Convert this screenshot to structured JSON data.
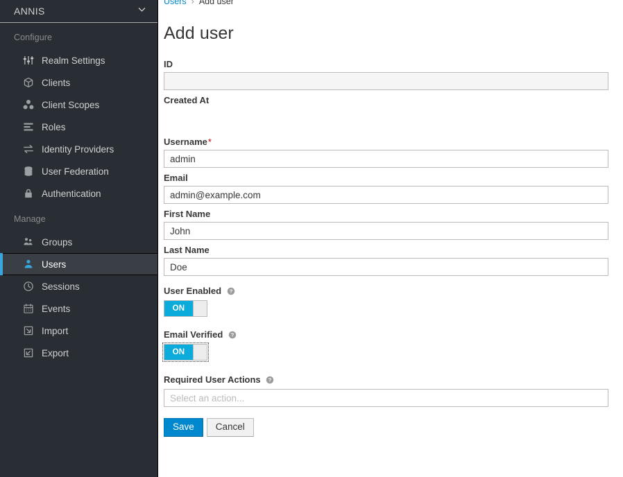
{
  "sidebar": {
    "realm": {
      "name": "ANNIS",
      "chevron_icon": "chevron-down-icon"
    },
    "sections": [
      {
        "title": "Configure",
        "items": [
          {
            "label": "Realm Settings",
            "icon": "sliders-icon",
            "active": false
          },
          {
            "label": "Clients",
            "icon": "cube-icon",
            "active": false
          },
          {
            "label": "Client Scopes",
            "icon": "molecule-icon",
            "active": false
          },
          {
            "label": "Roles",
            "icon": "list-bars-icon",
            "active": false
          },
          {
            "label": "Identity Providers",
            "icon": "exchange-arrows-icon",
            "active": false
          },
          {
            "label": "User Federation",
            "icon": "database-icon",
            "active": false
          },
          {
            "label": "Authentication",
            "icon": "lock-icon",
            "active": false
          }
        ]
      },
      {
        "title": "Manage",
        "items": [
          {
            "label": "Groups",
            "icon": "users-group-icon",
            "active": false
          },
          {
            "label": "Users",
            "icon": "user-icon",
            "active": true
          },
          {
            "label": "Sessions",
            "icon": "clock-icon",
            "active": false
          },
          {
            "label": "Events",
            "icon": "calendar-icon",
            "active": false
          },
          {
            "label": "Import",
            "icon": "import-arrow-icon",
            "active": false
          },
          {
            "label": "Export",
            "icon": "export-arrow-icon",
            "active": false
          }
        ]
      }
    ]
  },
  "breadcrumb": {
    "parent": "Users",
    "separator": "›",
    "current": "Add user"
  },
  "page": {
    "title": "Add user"
  },
  "form": {
    "id": {
      "label": "ID",
      "value": "",
      "placeholder": ""
    },
    "created_at": {
      "label": "Created At",
      "value": ""
    },
    "username": {
      "label": "Username",
      "required_marker": "*",
      "value": "admin"
    },
    "email": {
      "label": "Email",
      "value": "admin@example.com"
    },
    "first_name": {
      "label": "First Name",
      "value": "John"
    },
    "last_name": {
      "label": "Last Name",
      "value": "Doe"
    },
    "user_enabled": {
      "label": "User Enabled",
      "state": "ON",
      "help_icon": "help-circle-icon"
    },
    "email_verified": {
      "label": "Email Verified",
      "state": "ON",
      "help_icon": "help-circle-icon"
    },
    "required_user_actions": {
      "label": "Required User Actions",
      "placeholder": "Select an action...",
      "value": "",
      "help_icon": "help-circle-icon"
    }
  },
  "actions": {
    "save_label": "Save",
    "cancel_label": "Cancel"
  },
  "colors": {
    "sidebar_bg": "#292e34",
    "sidebar_active_bg": "#393f44",
    "accent_blue": "#39a5dc",
    "primary_blue": "#0088ce",
    "toggle_on_blue": "#0bacdb",
    "link_blue": "#0088ce",
    "required_red": "#cc0000"
  }
}
